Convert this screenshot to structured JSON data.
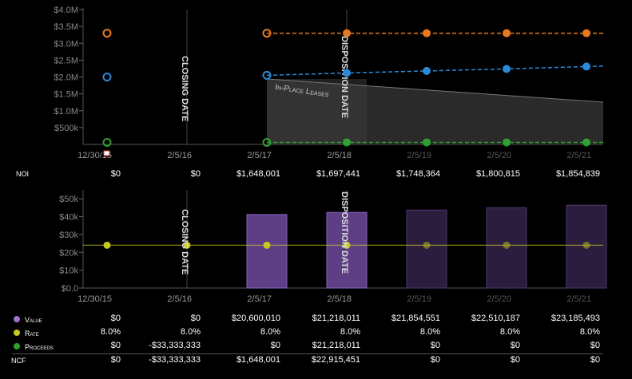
{
  "colors": {
    "value": "#a070d0",
    "rate": "#c8c81e",
    "proceeds": "#2fa02f",
    "orange": "#e8791f",
    "blue": "#2a8ad8"
  },
  "top_chart": {
    "y_ticks": [
      "$4.0M",
      "$3.5M",
      "$3.0M",
      "$2.5M",
      "$2.0M",
      "$1.5M",
      "$1.0M",
      "$500k"
    ],
    "x_ticks": [
      "12/30/15",
      "2/5/16",
      "2/5/17",
      "2/5/18",
      "2/5/19",
      "2/5/20",
      "2/5/21"
    ],
    "closing_label": "CLOSING DATE",
    "disposition_label": "DISPOSITION DATE",
    "inplace_label": "In-Place Leases"
  },
  "noi": {
    "label": "NOI",
    "values": [
      "$0",
      "$0",
      "$1,648,001",
      "$1,697,441",
      "$1,748,364",
      "$1,800,815",
      "$1,854,839"
    ]
  },
  "bottom_chart": {
    "y_ticks": [
      "$50k",
      "$40k",
      "$30k",
      "$20k",
      "$10k",
      "$0.0"
    ],
    "x_ticks": [
      "12/30/15",
      "2/5/16",
      "2/5/17",
      "2/5/18",
      "2/5/19",
      "2/5/20",
      "2/5/21"
    ],
    "closing_label": "CLOSING DATE",
    "disposition_label": "DISPOSITION DATE"
  },
  "table": {
    "value": {
      "label": "Value",
      "values": [
        "$0",
        "$0",
        "$20,600,010",
        "$21,218,011",
        "$21,854,551",
        "$22,510,187",
        "$23,185,493"
      ]
    },
    "rate": {
      "label": "Rate",
      "values": [
        "8.0%",
        "8.0%",
        "8.0%",
        "8.0%",
        "8.0%",
        "8.0%",
        "8.0%"
      ]
    },
    "proceeds": {
      "label": "Proceeds",
      "values": [
        "$0",
        "-$33,333,333",
        "$0",
        "$21,218,011",
        "$0",
        "$0",
        "$0"
      ]
    },
    "ncf": {
      "label": "NCF",
      "values": [
        "$0",
        "-$33,333,333",
        "$1,648,001",
        "$22,915,451",
        "$0",
        "$0",
        "$0"
      ]
    }
  },
  "chart_data": [
    {
      "type": "line",
      "x": [
        "12/30/15",
        "2/5/16",
        "2/5/17",
        "2/5/18",
        "2/5/19",
        "2/5/20",
        "2/5/21"
      ],
      "ylim": [
        0,
        4000000
      ],
      "series": [
        {
          "values": [
            3300000,
            null,
            3300000,
            3300000,
            3300000,
            3300000,
            3300000
          ]
        },
        {
          "values": [
            2000000,
            null,
            2050000,
            2120000,
            2180000,
            2240000,
            2310000
          ]
        },
        {
          "values": [
            60000,
            null,
            60000,
            60000,
            60000,
            60000,
            60000
          ]
        }
      ]
    },
    {
      "type": "bar",
      "categories": [
        "12/30/15",
        "2/5/16",
        "2/5/17",
        "2/5/18",
        "2/5/19",
        "2/5/20",
        "2/5/21"
      ],
      "ylim": [
        0,
        55000
      ],
      "values": [
        0,
        0,
        41200,
        42400,
        43700,
        45000,
        46400
      ],
      "rate_line": 24000
    }
  ]
}
